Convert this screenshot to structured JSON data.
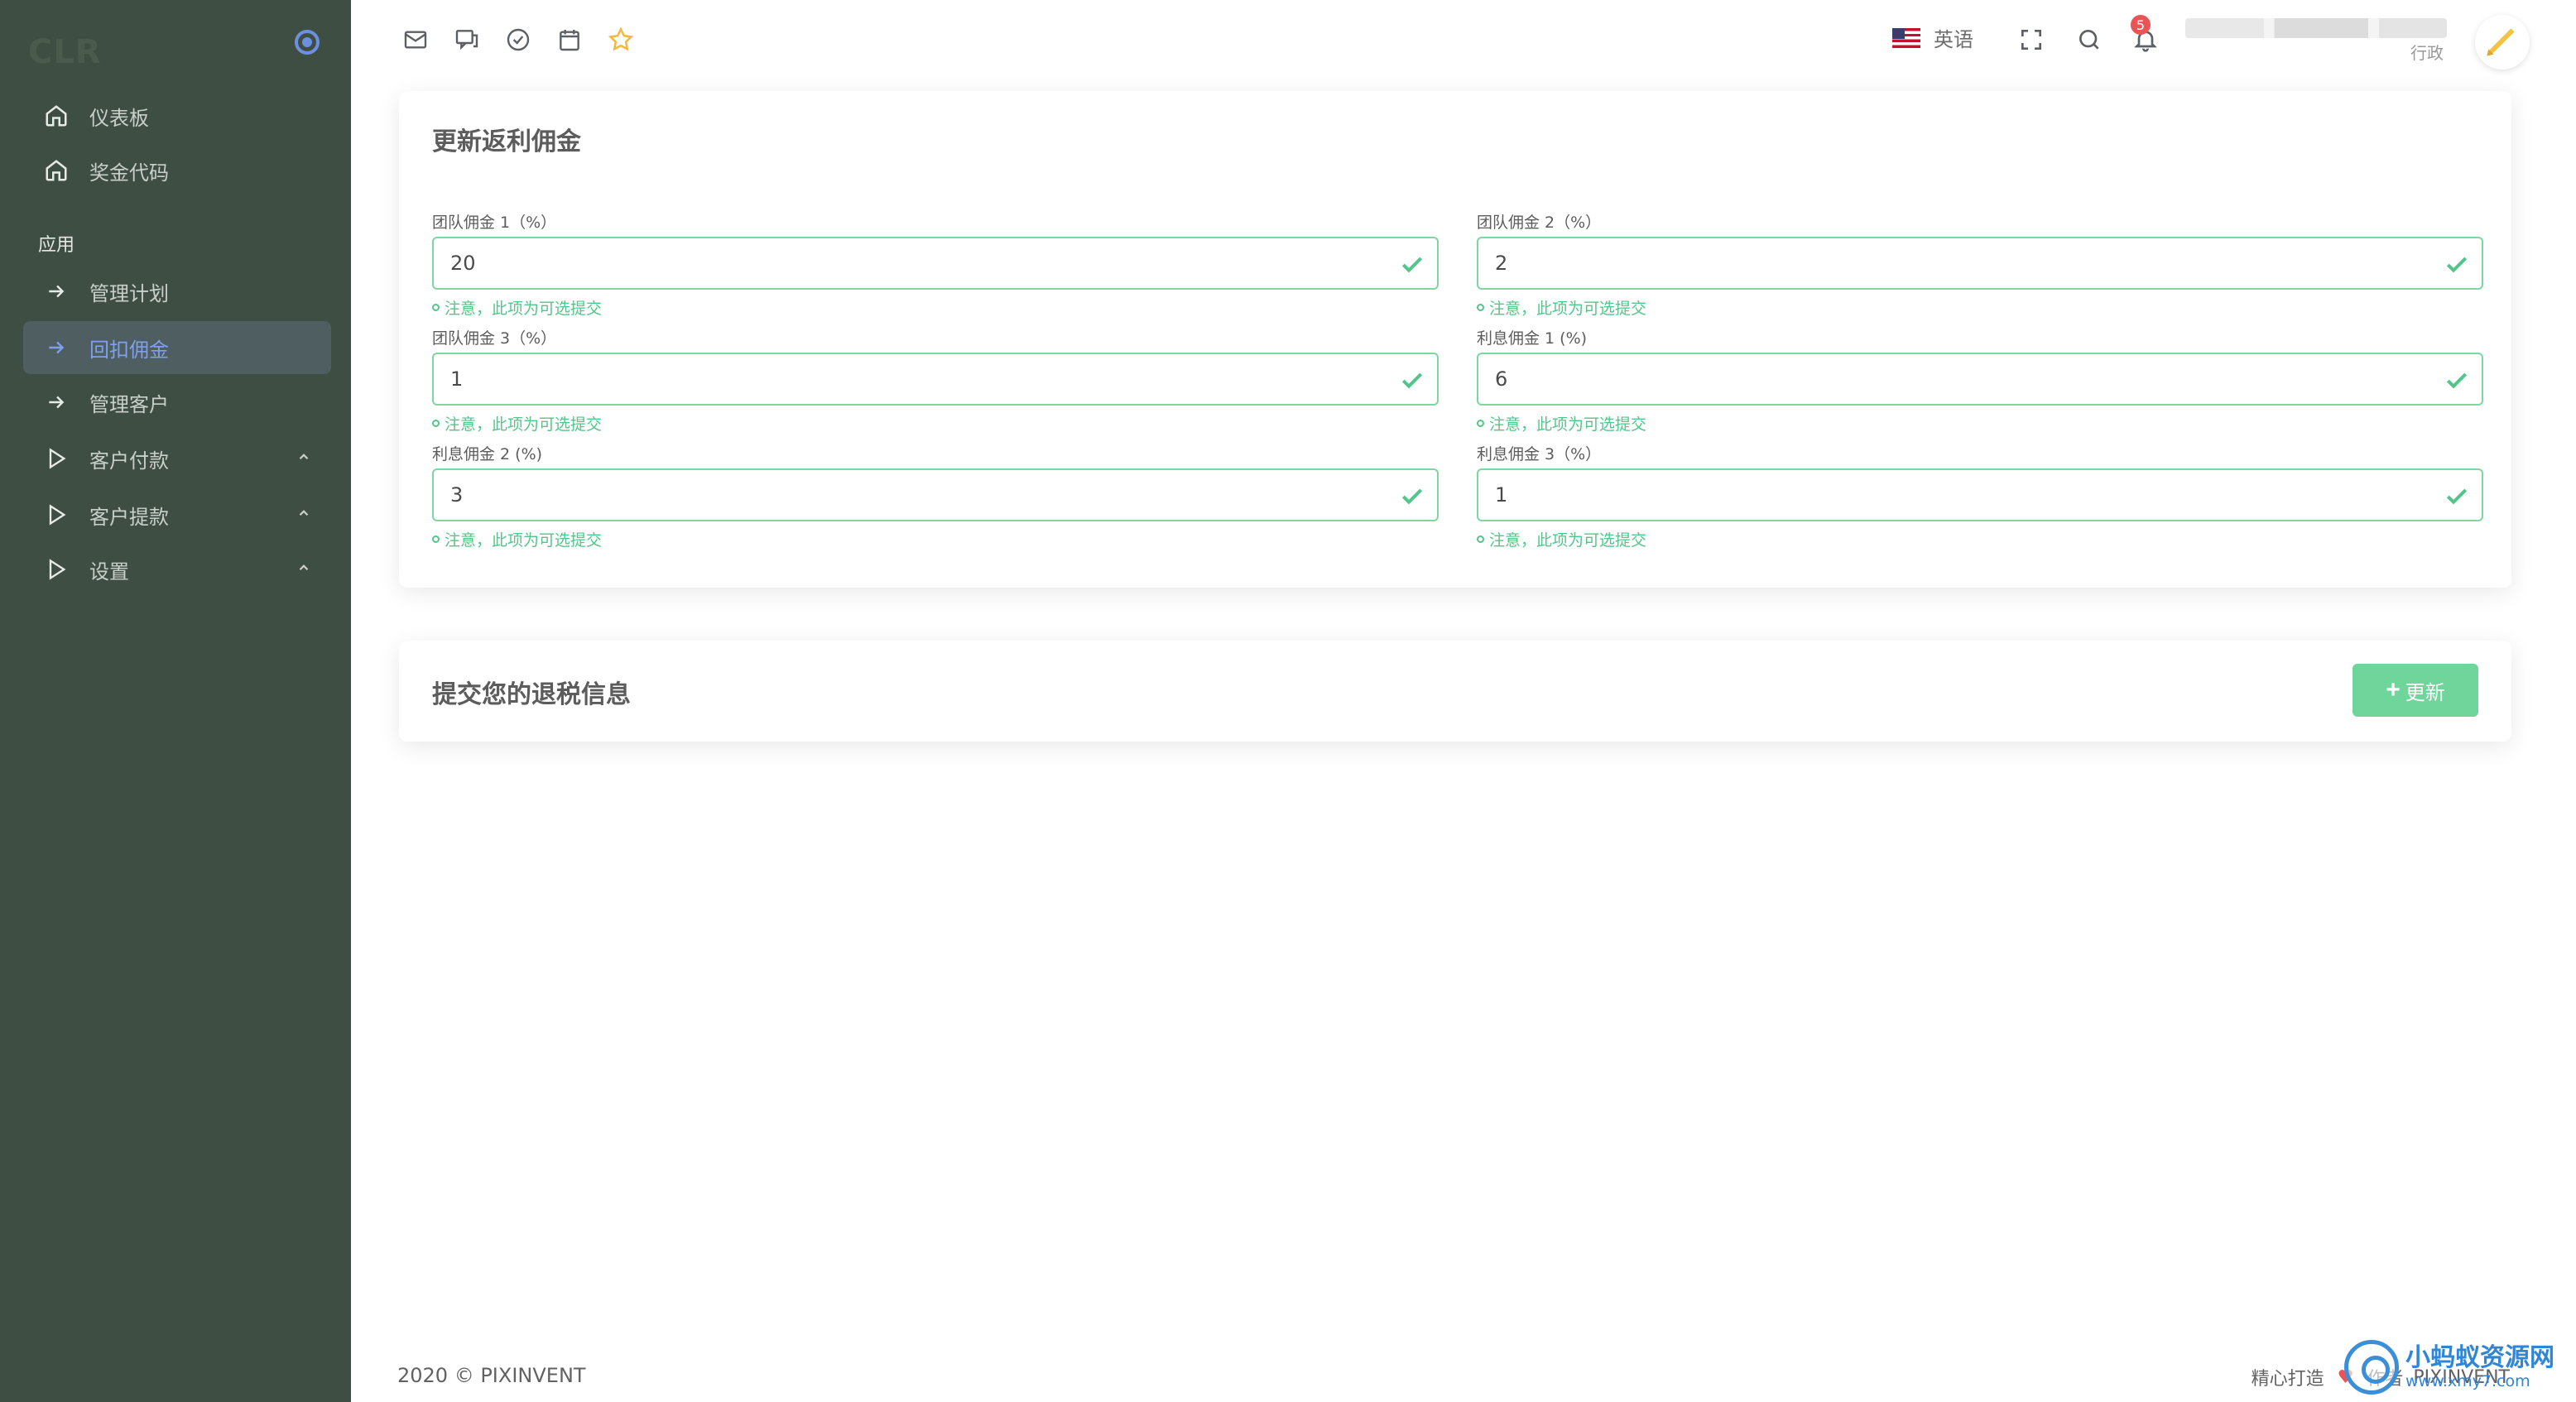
{
  "app": {
    "brand": "CLR"
  },
  "sidebar": {
    "section_header": "应用",
    "items": [
      {
        "label": "仪表板",
        "icon": "home-icon"
      },
      {
        "label": "奖金代码",
        "icon": "home-icon"
      },
      {
        "label": "管理计划",
        "icon": "arrow-right-icon"
      },
      {
        "label": "回扣佣金",
        "icon": "arrow-right-icon",
        "active": true
      },
      {
        "label": "管理客户",
        "icon": "arrow-right-icon"
      },
      {
        "label": "客户付款",
        "icon": "play-icon",
        "expandable": true
      },
      {
        "label": "客户提款",
        "icon": "play-icon",
        "expandable": true
      },
      {
        "label": "设置",
        "icon": "play-icon",
        "expandable": true
      }
    ]
  },
  "topbar": {
    "icons": [
      "mail-icon",
      "chat-icon",
      "check-circle-icon",
      "calendar-icon",
      "star-icon"
    ],
    "language": "英语",
    "notifications_count": "5",
    "user_role": "行政"
  },
  "commission_card": {
    "title": "更新返利佣金",
    "fields": [
      {
        "label": "团队佣金 1（%）",
        "value": "20",
        "hint": "注意，此项为可选提交"
      },
      {
        "label": "团队佣金 2（%）",
        "value": "2",
        "hint": "注意，此项为可选提交"
      },
      {
        "label": "团队佣金 3（%）",
        "value": "1",
        "hint": "注意，此项为可选提交"
      },
      {
        "label": "利息佣金 1 (%)",
        "value": "6",
        "hint": "注意，此项为可选提交"
      },
      {
        "label": "利息佣金 2 (%)",
        "value": "3",
        "hint": "注意，此项为可选提交"
      },
      {
        "label": "利息佣金 3（%）",
        "value": "1",
        "hint": "注意，此项为可选提交"
      }
    ]
  },
  "submit_card": {
    "title": "提交您的退税信息",
    "button_label": "更新"
  },
  "footer": {
    "copyright": "2020 © PIXINVENT",
    "crafted": "精心打造",
    "author_prefix": "作者",
    "author": "PIXINVENT"
  },
  "watermark": {
    "title": "小蚂蚁资源网",
    "url": "www.xmy7.com"
  },
  "colors": {
    "sidebar_bg": "#3f4e42",
    "accent_blue": "#7fa1ec",
    "success_green": "#52c68a",
    "button_green": "#6fd59a",
    "badge_red": "#ea5455"
  }
}
